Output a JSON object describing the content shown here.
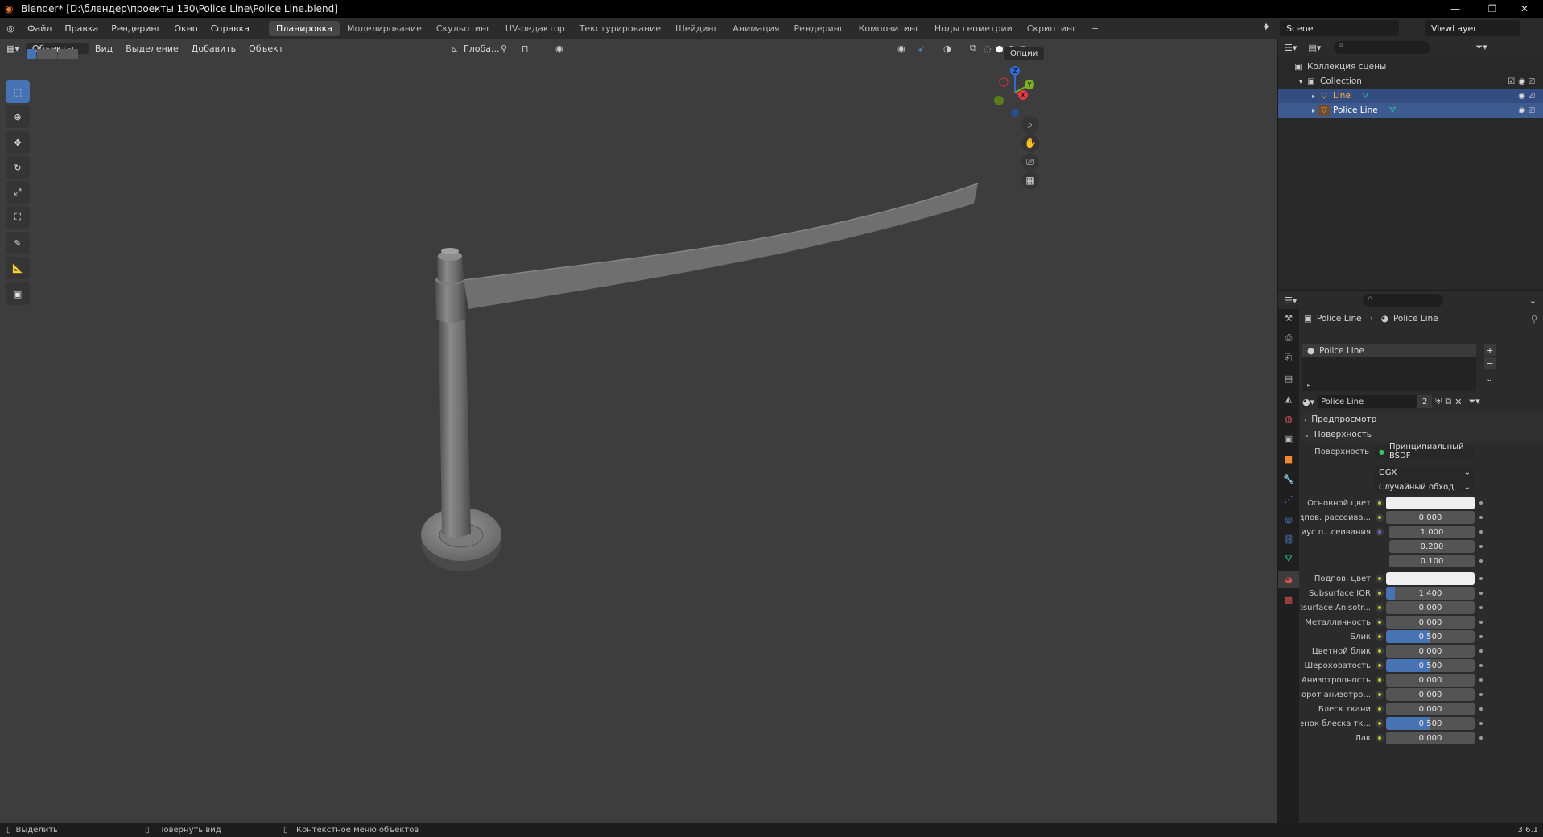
{
  "window": {
    "title": "Blender* [D:\\блендер\\проекты 130\\Police Line\\Police Line.blend]",
    "minimize": "—",
    "maximize": "❐",
    "close": "✕"
  },
  "menu": [
    "Файл",
    "Правка",
    "Рендеринг",
    "Окно",
    "Справка"
  ],
  "workspaces": [
    "Планировка",
    "Моделирование",
    "Скульптинг",
    "UV-редактор",
    "Текстурирование",
    "Шейдинг",
    "Анимация",
    "Рендеринг",
    "Композитинг",
    "Ноды геометрии",
    "Скриптинг"
  ],
  "workspace_add": "+",
  "scene": "Scene",
  "view_layer": "ViewLayer",
  "viewport_header": {
    "mode": "Объекты",
    "view": "Вид",
    "select": "Выделение",
    "add": "Добавить",
    "object": "Объект",
    "orientation": "Глоба...",
    "options": "Опции"
  },
  "gizmo": {
    "z": "Z",
    "y": "Y",
    "x": "X"
  },
  "outliner": {
    "scene_collection": "Коллекция сцены",
    "collection": "Collection",
    "items": [
      {
        "name": "Line",
        "selected": true
      },
      {
        "name": "Police Line",
        "selected": true
      }
    ]
  },
  "properties": {
    "breadcrumb_object": "Police Line",
    "breadcrumb_material": "Police Line",
    "material_slot": "Police Line",
    "material_name": "Police Line",
    "users": "2",
    "preview_section": "Предпросмотр",
    "surface_section": "Поверхность",
    "surface_label": "Поверхность",
    "surface_value": "Принципиальный BSDF",
    "distribution": "GGX",
    "subsurface_method": "Случайный обход",
    "rows": [
      {
        "label": "Основной цвет",
        "value": "",
        "type": "color",
        "fill": 0
      },
      {
        "label": "Подпов. рассеива...",
        "value": "0.000",
        "type": "num",
        "fill": 0
      },
      {
        "label": "Радиус п...сеивания",
        "value": "1.000",
        "type": "vec",
        "fill": 0
      },
      {
        "label": "",
        "value": "0.200",
        "type": "vec",
        "fill": 0
      },
      {
        "label": "",
        "value": "0.100",
        "type": "vec",
        "fill": 0
      },
      {
        "label": "Подпов. цвет",
        "value": "",
        "type": "color",
        "fill": 0
      },
      {
        "label": "Subsurface IOR",
        "value": "1.400",
        "type": "num",
        "fill": 0.1
      },
      {
        "label": "Subsurface Anisotr...",
        "value": "0.000",
        "type": "num",
        "fill": 0
      },
      {
        "label": "Металличность",
        "value": "0.000",
        "type": "num",
        "fill": 0
      },
      {
        "label": "Блик",
        "value": "0.500",
        "type": "num",
        "fill": 0.5
      },
      {
        "label": "Цветной блик",
        "value": "0.000",
        "type": "num",
        "fill": 0
      },
      {
        "label": "Шероховатость",
        "value": "0.500",
        "type": "num",
        "fill": 0.5
      },
      {
        "label": "Анизотропность",
        "value": "0.000",
        "type": "num",
        "fill": 0
      },
      {
        "label": "Поворот анизотро...",
        "value": "0.000",
        "type": "num",
        "fill": 0
      },
      {
        "label": "Блеск ткани",
        "value": "0.000",
        "type": "num",
        "fill": 0
      },
      {
        "label": "Оттенок блеска тк...",
        "value": "0.500",
        "type": "num",
        "fill": 0.5
      },
      {
        "label": "Лак",
        "value": "0.000",
        "type": "num",
        "fill": 0
      }
    ]
  },
  "status": {
    "select": "Выделить",
    "rotate": "Повернуть вид",
    "context": "Контекстное меню объектов",
    "version": "3.6.1"
  },
  "colors": {
    "accent": "#4772b3",
    "selection": "#334d80",
    "viewport": "#3d3d3d"
  }
}
